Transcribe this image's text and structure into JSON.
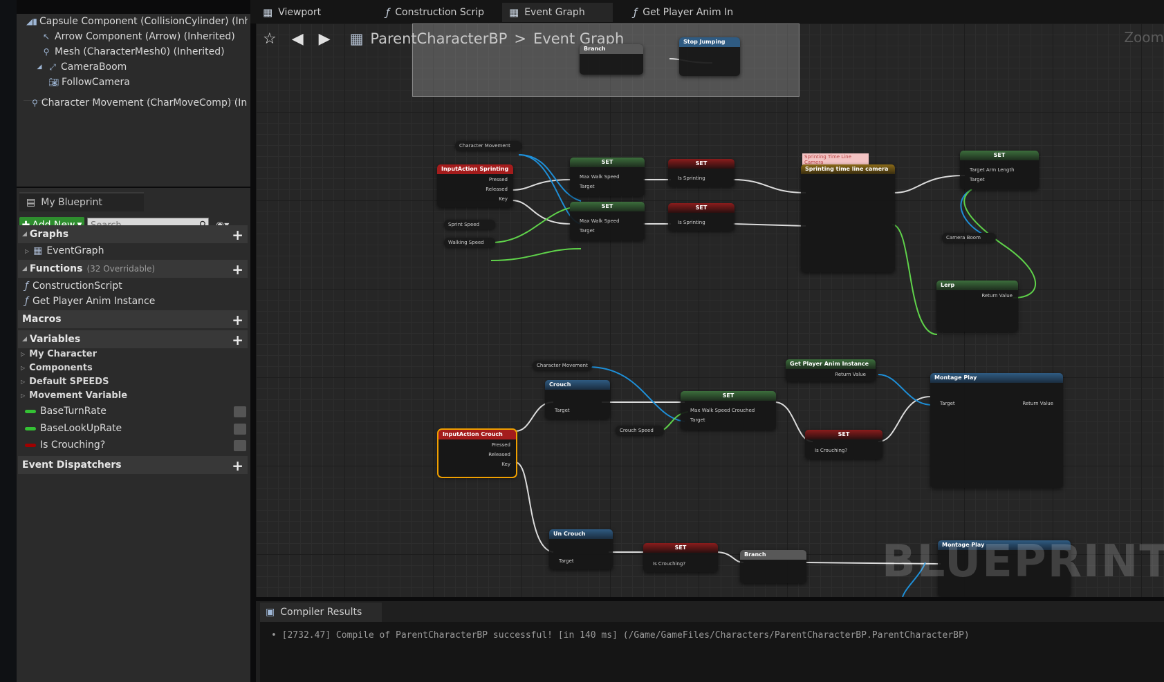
{
  "components": {
    "items": [
      {
        "label": "Capsule Component (CollisionCylinder) (Inhe",
        "icon": "capsule-icon"
      },
      {
        "label": "Arrow Component (Arrow) (Inherited)",
        "icon": "arrow-icon"
      },
      {
        "label": "Mesh (CharacterMesh0) (Inherited)",
        "icon": "mesh-icon"
      },
      {
        "label": "CameraBoom",
        "icon": "spring-arm-icon"
      },
      {
        "label": "FollowCamera",
        "icon": "camera-icon"
      },
      {
        "label": "Character Movement (CharMoveComp) (Inhe",
        "icon": "movement-icon"
      }
    ]
  },
  "my_blueprint": {
    "tab_label": "My Blueprint",
    "add_new_label": "Add New",
    "search_placeholder": "Search",
    "graphs": {
      "label": "Graphs",
      "items": [
        "EventGraph"
      ]
    },
    "functions": {
      "label": "Functions",
      "overridable": "(32 Overridable)",
      "items": [
        "ConstructionScript",
        "Get Player Anim Instance"
      ]
    },
    "macros": {
      "label": "Macros"
    },
    "variables": {
      "label": "Variables",
      "groups": [
        "My Character",
        "Components",
        "Default SPEEDS",
        "Movement Variable"
      ],
      "items": [
        {
          "label": "BaseTurnRate",
          "color": "#34c134"
        },
        {
          "label": "BaseLookUpRate",
          "color": "#34c134"
        },
        {
          "label": "Is Crouching?",
          "color": "#a00000"
        }
      ]
    },
    "event_dispatchers": {
      "label": "Event Dispatchers"
    }
  },
  "tabs": [
    {
      "label": "Viewport",
      "icon": "viewport-icon"
    },
    {
      "label": "Construction Scrip",
      "icon": "function-icon"
    },
    {
      "label": "Event Graph",
      "icon": "graph-icon"
    },
    {
      "label": "Get Player Anim In",
      "icon": "function-icon"
    }
  ],
  "graph": {
    "breadcrumb_blueprint": "ParentCharacterBP",
    "breadcrumb_separator": ">",
    "breadcrumb_graph": "Event Graph",
    "zoom_label": "Zoom",
    "watermark": "BLUEPRINT",
    "nodes": {
      "branch_top": "Branch",
      "stop_jumping": "Stop Jumping",
      "inputaction_sprinting": "InputAction Sprinting",
      "set": "SET",
      "character_movement": "Character Movement",
      "sprint_speed": "Sprint Speed",
      "walking_speed": "Walking Speed",
      "max_walk_speed": "Max Walk Speed",
      "target": "Target",
      "is_sprinting": "Is Sprinting",
      "timeline_comment": "Sprinting Time Line Camera",
      "timeline": "Sprinting time line camera",
      "camera_boom": "Camera Boom",
      "lerp": "Lerp",
      "target_arm_length": "Target Arm Length",
      "inputaction_crouch": "InputAction Crouch",
      "crouch": "Crouch",
      "crouch_speed": "Crouch Speed",
      "max_walk_speed_crouched": "Max Walk Speed Crouched",
      "is_crouching": "Is Crouching?",
      "get_player_anim": "Get Player Anim Instance",
      "montage_play": "Montage Play",
      "un_crouch": "Un Crouch",
      "branch_bottom": "Branch",
      "pressed": "Pressed",
      "released": "Released",
      "key": "Key",
      "return_value": "Return Value"
    }
  },
  "compiler": {
    "tab_label": "Compiler Results",
    "message": "[2732.47] Compile of ParentCharacterBP successful! [in 140 ms] (/Game/GameFiles/Characters/ParentCharacterBP.ParentCharacterBP)"
  }
}
